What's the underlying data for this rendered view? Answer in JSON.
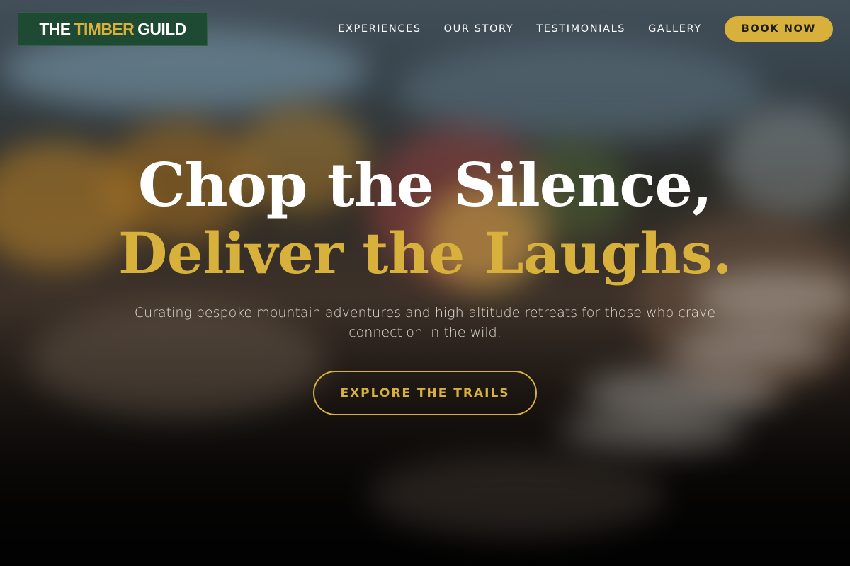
{
  "brand": {
    "logo_part1": "THE",
    "logo_accent": "TIMBER",
    "logo_part2": "GUILD"
  },
  "nav": {
    "items": [
      {
        "label": "EXPERIENCES"
      },
      {
        "label": "OUR STORY"
      },
      {
        "label": "TESTIMONIALS"
      },
      {
        "label": "GALLERY"
      }
    ],
    "book_label": "BOOK NOW"
  },
  "hero": {
    "headline_line1": "Chop the Silence,",
    "headline_line2": "Deliver the Laughs.",
    "subtitle": "Curating bespoke mountain adventures and high-altitude retreats for those who crave connection in the wild.",
    "cta_label": "EXPLORE THE TRAILS"
  },
  "colors": {
    "accent_gold": "#d8b13c",
    "logo_green": "#1e4a34",
    "text_white": "#ffffff"
  }
}
